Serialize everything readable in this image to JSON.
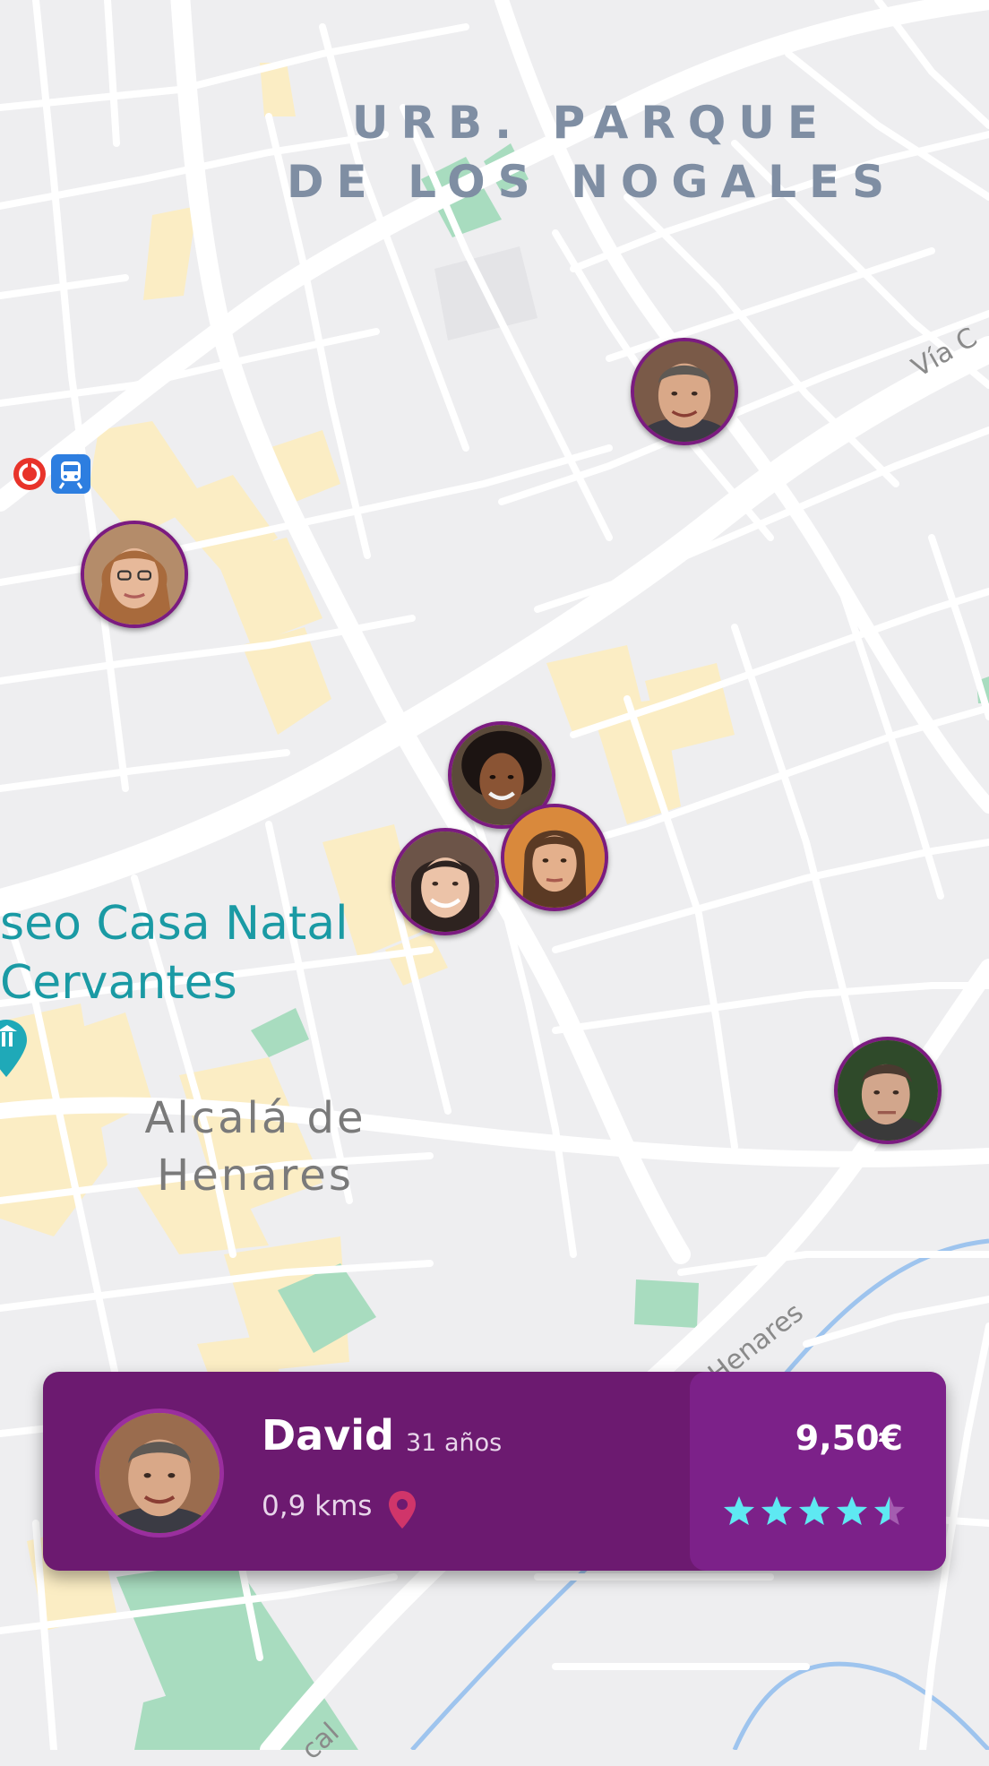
{
  "map": {
    "district_label_line1": "URB. PARQUE",
    "district_label_line2": "DE LOS NOGALES",
    "poi_label_line1": "seo Casa Natal",
    "poi_label_line2": "Cervantes",
    "city_label_line1": "Alcalá de",
    "city_label_line2": "Henares",
    "road_label_via": "Vía C",
    "road_label_henares": "l Henares",
    "road_label_bottom": "cal",
    "colors": {
      "background": "#eeeef0",
      "road": "#ffffff",
      "building_area": "#fbedc4",
      "park": "#a8dcbf",
      "river": "#9ec4ee",
      "poi": "#1a9aa4"
    }
  },
  "pins": [
    {
      "name": "pin-man-top-right"
    },
    {
      "name": "pin-woman-glasses"
    },
    {
      "name": "pin-woman-curly"
    },
    {
      "name": "pin-woman-smiling"
    },
    {
      "name": "pin-woman-young"
    },
    {
      "name": "pin-man-right"
    }
  ],
  "card": {
    "name": "David",
    "age": "31 años",
    "distance": "0,9 kms",
    "price": "9,50€",
    "rating": 4.5,
    "rating_max": 5,
    "colors": {
      "card_bg": "#6c1a70",
      "price_panel_bg": "#7c2189",
      "star": "#5ee9f2",
      "pin_icon": "#d0356a"
    }
  }
}
